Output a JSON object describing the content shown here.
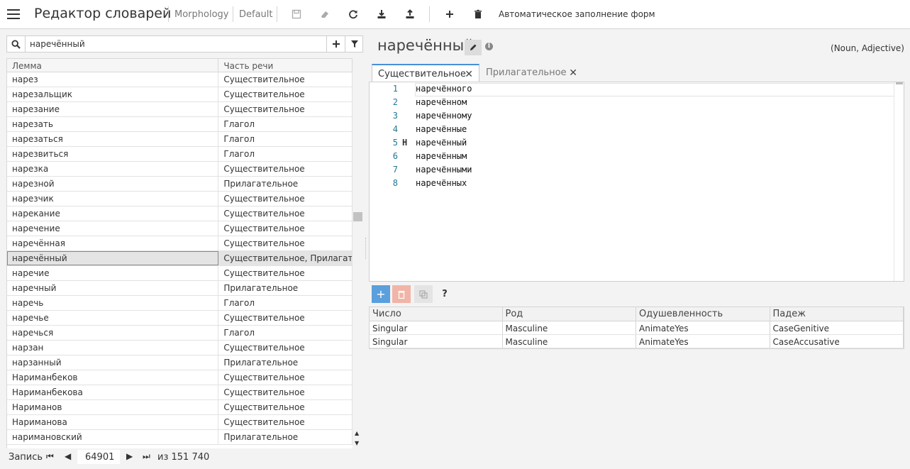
{
  "app": {
    "title": "Редактор словарей",
    "crumb_project": "Morphology",
    "crumb_profile": "Default",
    "autofill_label": "Автоматическое заполнение форм"
  },
  "toolbar": {
    "icons": [
      "save-icon",
      "eraser-icon",
      "refresh-icon",
      "download-icon",
      "upload-icon",
      "plus-icon",
      "trash-icon"
    ]
  },
  "search": {
    "value": "наречённый"
  },
  "list": {
    "headers": [
      "Лемма",
      "Часть речи"
    ],
    "rows": [
      [
        "нарез",
        "Существительное"
      ],
      [
        "нарезальщик",
        "Существительное"
      ],
      [
        "нарезание",
        "Существительное"
      ],
      [
        "нарезать",
        "Глагол"
      ],
      [
        "нарезаться",
        "Глагол"
      ],
      [
        "нарезвиться",
        "Глагол"
      ],
      [
        "нарезка",
        "Существительное"
      ],
      [
        "нарезной",
        "Прилагательное"
      ],
      [
        "нарезчик",
        "Существительное"
      ],
      [
        "нарекание",
        "Существительное"
      ],
      [
        "наречение",
        "Существительное"
      ],
      [
        "наречённая",
        "Существительное"
      ],
      [
        "наречённый",
        "Существительное, Прилагательное"
      ],
      [
        "наречие",
        "Существительное"
      ],
      [
        "наречный",
        "Прилагательное"
      ],
      [
        "наречь",
        "Глагол"
      ],
      [
        "наречье",
        "Существительное"
      ],
      [
        "наречься",
        "Глагол"
      ],
      [
        "нарзан",
        "Существительное"
      ],
      [
        "нарзанный",
        "Прилагательное"
      ],
      [
        "Нариманбеков",
        "Существительное"
      ],
      [
        "Нариманбекова",
        "Существительное"
      ],
      [
        "Нариманов",
        "Существительное"
      ],
      [
        "Нариманова",
        "Существительное"
      ],
      [
        "наримановский",
        "Прилагательное"
      ]
    ],
    "selected_index": 12
  },
  "pager": {
    "label": "Запись",
    "current": "64901",
    "total": "из 151 740"
  },
  "entry": {
    "word": "наречённый",
    "tags": "(Noun, Adjective)",
    "tabs": [
      {
        "label": "Существительное",
        "active": true
      },
      {
        "label": "Прилагательное",
        "active": false
      }
    ]
  },
  "editor": {
    "lines": [
      {
        "num": "1",
        "mark": "",
        "text": "наречённого"
      },
      {
        "num": "2",
        "mark": "",
        "text": "наречённом"
      },
      {
        "num": "3",
        "mark": "",
        "text": "наречённому"
      },
      {
        "num": "4",
        "mark": "",
        "text": "наречённые"
      },
      {
        "num": "5",
        "mark": "Н",
        "text": "наречённый"
      },
      {
        "num": "6",
        "mark": "",
        "text": "наречённым"
      },
      {
        "num": "7",
        "mark": "",
        "text": "наречёнными"
      },
      {
        "num": "8",
        "mark": "",
        "text": "наречённых"
      }
    ]
  },
  "grammar": {
    "help_label": "?",
    "headers": [
      "Число",
      "Род",
      "Одушевленность",
      "Падеж"
    ],
    "rows": [
      [
        "Singular",
        "Masculine",
        "AnimateYes",
        "CaseGenitive"
      ],
      [
        "Singular",
        "Masculine",
        "AnimateYes",
        "CaseAccusative"
      ]
    ]
  }
}
